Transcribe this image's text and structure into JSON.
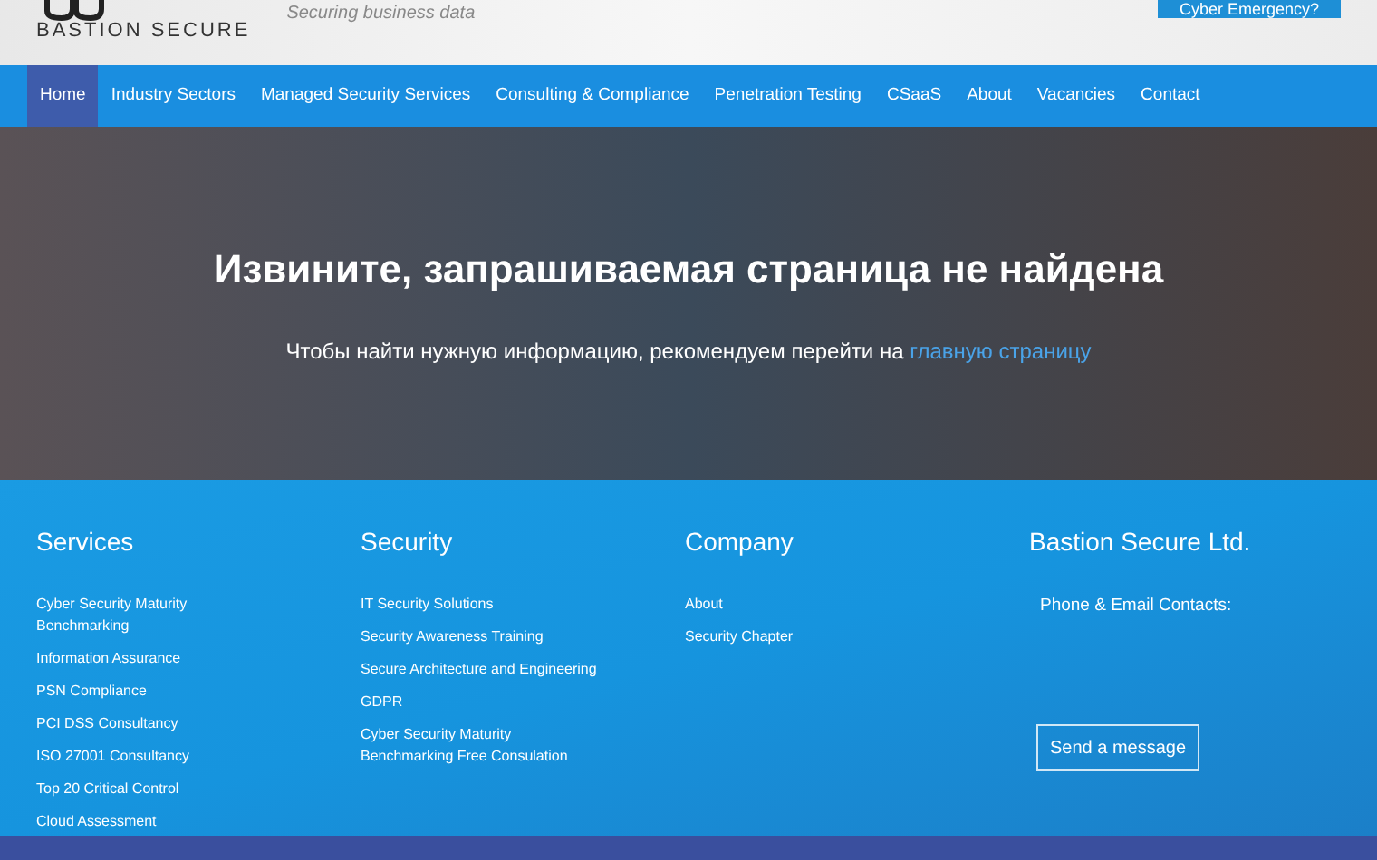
{
  "header": {
    "logo_text": "BASTION SECURE",
    "tagline": "Securing business data",
    "emergency_button": "Cyber Emergency?"
  },
  "nav": [
    {
      "label": "Home",
      "selected": true
    },
    {
      "label": "Industry Sectors",
      "selected": false
    },
    {
      "label": "Managed Security Services",
      "selected": false
    },
    {
      "label": "Consulting & Compliance",
      "selected": false
    },
    {
      "label": "Penetration Testing",
      "selected": false
    },
    {
      "label": "CSaaS",
      "selected": false
    },
    {
      "label": "About",
      "selected": false
    },
    {
      "label": "Vacancies",
      "selected": false
    },
    {
      "label": "Contact",
      "selected": false
    }
  ],
  "hero": {
    "title": "Извините, запрашиваемая страница не найдена",
    "text": "Чтобы найти нужную информацию, рекомендуем перейти на",
    "link": "главную страницу"
  },
  "footer": {
    "columns": [
      {
        "heading": "Services",
        "links": [
          "Cyber Security Maturity Benchmarking",
          "Information Assurance",
          "PSN Compliance",
          "PCI DSS Consultancy",
          "ISO 27001 Consultancy",
          "Top 20 Critical Control",
          "Cloud Assessment"
        ]
      },
      {
        "heading": "Security",
        "links": [
          "IT Security Solutions",
          "Security Awareness Training",
          "Secure Architecture and Engineering",
          "GDPR",
          "Cyber Security Maturity Benchmarking Free Consulation"
        ]
      },
      {
        "heading": "Company",
        "links": [
          "About",
          "Security Chapter"
        ]
      }
    ],
    "contact": {
      "heading": "Bastion Secure Ltd.",
      "label": "Phone & Email Contacts:",
      "button": "Send a message"
    }
  }
}
